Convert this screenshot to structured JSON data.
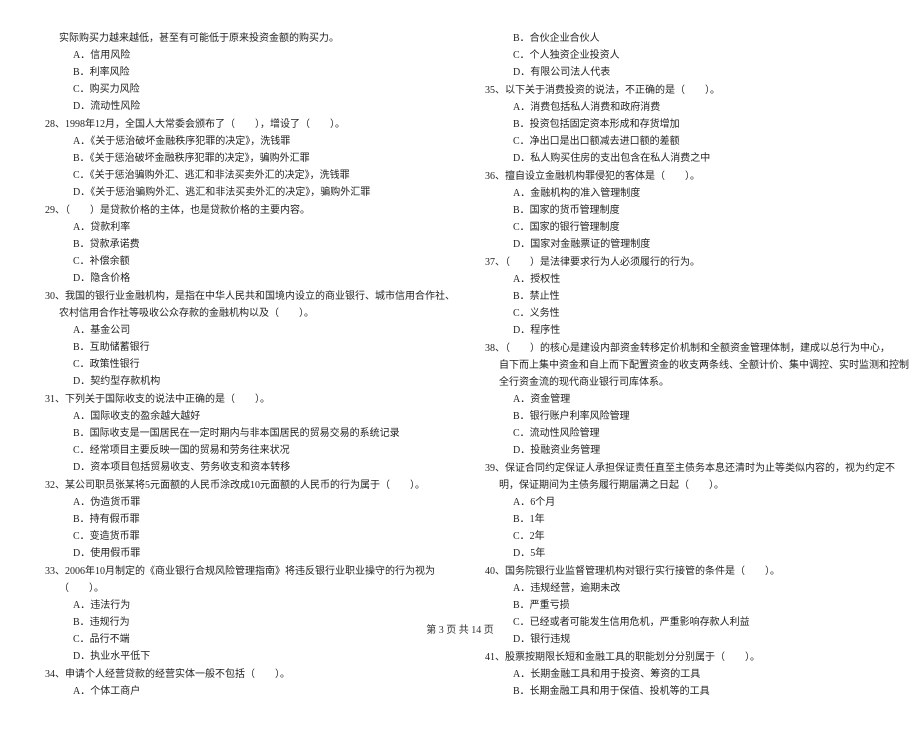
{
  "left": {
    "intro": "实际购买力越来越低，甚至有可能低于原来投资金额的购买力。",
    "introOpts": [
      "A．信用风险",
      "B．利率风险",
      "C．购买力风险",
      "D．流动性风险"
    ],
    "q28": "28、1998年12月，全国人大常委会颁布了（　　），增设了（　　）。",
    "q28Opts": [
      "A．《关于惩治破坏金融秩序犯罪的决定》，洗钱罪",
      "B．《关于惩治破坏金融秩序犯罪的决定》，骗购外汇罪",
      "C．《关于惩治骗购外汇、逃汇和非法买卖外汇的决定》，洗钱罪",
      "D．《关于惩治骗购外汇、逃汇和非法买卖外汇的决定》，骗购外汇罪"
    ],
    "q29": "29、（　　）是贷款价格的主体，也是贷款价格的主要内容。",
    "q29Opts": [
      "A．贷款利率",
      "B．贷款承诺费",
      "C．补偿余额",
      "D．隐含价格"
    ],
    "q30a": "30、我国的银行业金融机构，是指在中华人民共和国境内设立的商业银行、城市信用合作社、",
    "q30b": "农村信用合作社等吸收公众存款的金融机构以及（　　）。",
    "q30Opts": [
      "A．基金公司",
      "B．互助储蓄银行",
      "C．政策性银行",
      "D．契约型存款机构"
    ],
    "q31": "31、下列关于国际收支的说法中正确的是（　　）。",
    "q31Opts": [
      "A．国际收支的盈余越大越好",
      "B．国际收支是一国居民在一定时期内与非本国居民的贸易交易的系统记录",
      "C．经常项目主要反映一国的贸易和劳务往来状况",
      "D．资本项目包括贸易收支、劳务收支和资本转移"
    ],
    "q32": "32、某公司职员张某将5元面额的人民币涂改成10元面额的人民币的行为属于（　　）。",
    "q32Opts": [
      "A．伪造货币罪",
      "B．持有假币罪",
      "C．变造货币罪",
      "D．使用假币罪"
    ],
    "q33a": "33、2006年10月制定的《商业银行合规风险管理指南》将违反银行业职业操守的行为视为",
    "q33b": "（　　）。",
    "q33Opts": [
      "A．违法行为",
      "B．违规行为",
      "C．品行不端",
      "D．执业水平低下"
    ],
    "q34": "34、申请个人经营贷款的经营实体一般不包括（　　）。",
    "q34Opts": [
      "A．个体工商户"
    ]
  },
  "right": {
    "contOpts": [
      "B．合伙企业合伙人",
      "C．个人独资企业投资人",
      "D．有限公司法人代表"
    ],
    "q35": "35、以下关于消费投资的说法，不正确的是（　　）。",
    "q35Opts": [
      "A．消费包括私人消费和政府消费",
      "B．投资包括固定资本形成和存货增加",
      "C．净出口是出口额减去进口额的差额",
      "D．私人购买住房的支出包含在私人消费之中"
    ],
    "q36": "36、擅自设立金融机构罪侵犯的客体是（　　）。",
    "q36Opts": [
      "A．金融机构的准入管理制度",
      "B．国家的货币管理制度",
      "C．国家的银行管理制度",
      "D．国家对金融票证的管理制度"
    ],
    "q37": "37、（　　）是法律要求行为人必须履行的行为。",
    "q37Opts": [
      "A．授权性",
      "B．禁止性",
      "C．义务性",
      "D．程序性"
    ],
    "q38a": "38、（　　）的核心是建设内部资金转移定价机制和全额资金管理体制，建成以总行为中心，",
    "q38b": "自下而上集中资金和自上而下配置资金的收支两条线、全额计价、集中调控、实时监测和控制",
    "q38c": "全行资金流的现代商业银行司库体系。",
    "q38Opts": [
      "A．资金管理",
      "B．银行账户利率风险管理",
      "C．流动性风险管理",
      "D．投融资业务管理"
    ],
    "q39a": "39、保证合同约定保证人承担保证责任直至主债务本息还清时为止等类似内容的，视为约定不",
    "q39b": "明，保证期间为主债务履行期届满之日起（　　）。",
    "q39Opts": [
      "A．6个月",
      "B．1年",
      "C．2年",
      "D．5年"
    ],
    "q40": "40、国务院银行业监督管理机构对银行实行接管的条件是（　　）。",
    "q40Opts": [
      "A．违规经营，逾期未改",
      "B．严重亏损",
      "C．已经或者可能发生信用危机，严重影响存款人利益",
      "D．银行违规"
    ],
    "q41": "41、股票按期限长短和金融工具的职能划分分别属于（　　）。",
    "q41Opts": [
      "A．长期金融工具和用于投资、筹资的工具",
      "B．长期金融工具和用于保值、投机等的工具"
    ]
  },
  "footer": "第 3 页 共 14 页"
}
